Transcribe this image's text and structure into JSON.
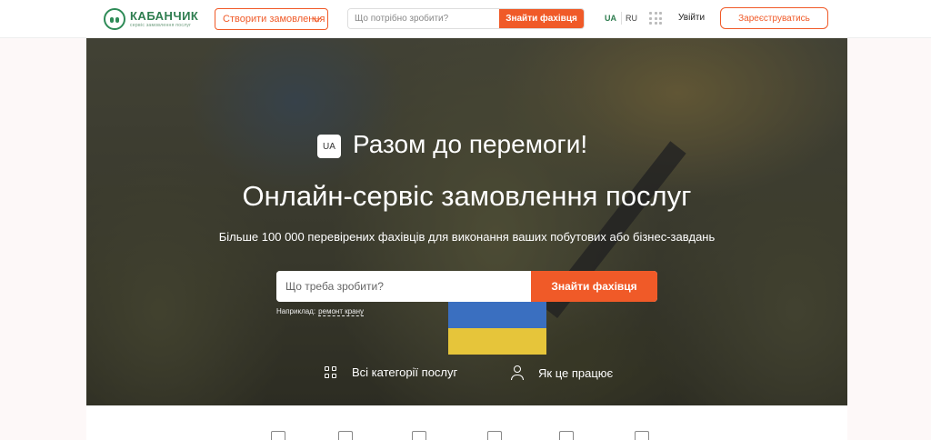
{
  "header": {
    "logo": {
      "name": "КАБАНЧИК",
      "tagline": "сервіс замовлення послуг"
    },
    "create_order_label": "Створити замовлення",
    "search": {
      "placeholder": "Що потрібно зробити?",
      "button_label": "Знайти фахівця"
    },
    "languages": [
      {
        "code": "UA",
        "active": true
      },
      {
        "code": "RU",
        "active": false
      }
    ],
    "login_label": "Увійти",
    "register_label": "Зареєструватись"
  },
  "hero": {
    "badge": "UA",
    "slogan": "Разом до перемоги!",
    "title": "Онлайн-сервіс замовлення послуг",
    "subtitle": "Більше 100 000 перевірених фахівців для виконання ваших побутових або бізнес-завдань",
    "search": {
      "placeholder": "Що треба зробити?",
      "button_label": "Знайти фахівця"
    },
    "example": {
      "prefix": "Наприклад:",
      "link": "ремонт крану"
    },
    "links": {
      "categories": "Всі категорії послуг",
      "how_it_works": "Як це працює"
    }
  },
  "colors": {
    "accent": "#f05a28",
    "brand_green": "#2e7d4f"
  },
  "category_icons": [
    "house-icon",
    "truck-icon",
    "broom-icon",
    "car-icon",
    "briefcase-icon",
    "grid-icon"
  ]
}
